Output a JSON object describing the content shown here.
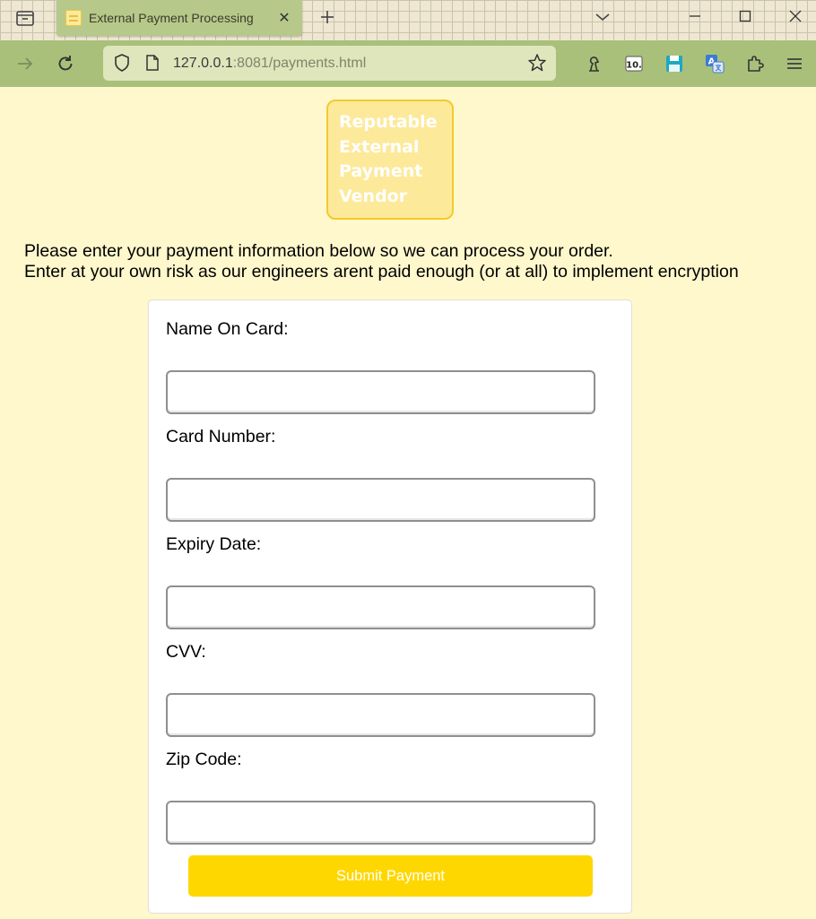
{
  "browser": {
    "tab_title": "External Payment Processing",
    "tab_close": "✕",
    "url_host": "127.0.0.1",
    "url_rest": ":8081/payments.html"
  },
  "page": {
    "logo_lines": [
      "Reputable",
      "External",
      "Payment",
      "Vendor"
    ],
    "intro_line1": "Please enter your payment information below so we can process your order.",
    "intro_line2": "Enter at your own risk as our engineers arent paid enough (or at all) to implement encryption",
    "form": {
      "fields": [
        {
          "label": "Name On Card:",
          "value": ""
        },
        {
          "label": "Card Number:",
          "value": ""
        },
        {
          "label": "Expiry Date:",
          "value": ""
        },
        {
          "label": "CVV:",
          "value": ""
        },
        {
          "label": "Zip Code:",
          "value": ""
        }
      ],
      "submit_label": "Submit Payment"
    }
  },
  "colors": {
    "page_background": "#fff8cc",
    "accent": "#ffd700",
    "logo_fill": "#fde99a",
    "logo_border": "#f4c92b",
    "toolbar": "#a9c07a"
  }
}
